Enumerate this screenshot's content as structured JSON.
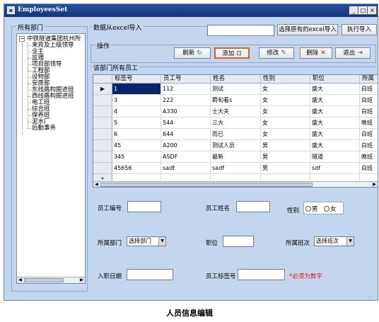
{
  "window": {
    "title": "EmployeesSet"
  },
  "titlebar_buttons": {
    "minimize": "_",
    "maximize": "□",
    "close": "×"
  },
  "sidebar": {
    "legend": "所有部门",
    "root": "中铁隧道集团杭州所",
    "items": [
      "来宾及上级领导",
      "业主",
      "监理",
      "项目部领导",
      "工程部",
      "设物部",
      "安质部",
      "东线盾构掘进班",
      "西线盾构掘进班",
      "电工班",
      "综合班",
      "保养班",
      "泥水厂",
      "后勤事务"
    ]
  },
  "import": {
    "legend": "数据从excel导入",
    "path_value": "",
    "choose_button": "选择原有的excel导入",
    "execute_button": "执行导入"
  },
  "actions": {
    "legend": "操作",
    "refresh": "刷新",
    "add": "添加",
    "edit": "修改",
    "delete": "删除",
    "exit": "退出"
  },
  "grid": {
    "legend": "该部门所有员工",
    "columns": [
      "标签号",
      "员工号",
      "姓名",
      "性别",
      "职位",
      "所属"
    ],
    "rows": [
      [
        "1",
        "112",
        "测试",
        "女",
        "盛大",
        "白班"
      ],
      [
        "3",
        "222",
        "羁旬看s",
        "女",
        "盛大",
        "白班"
      ],
      [
        "4",
        "A330",
        "士大夫",
        "女",
        "盛大",
        "白班"
      ],
      [
        "5",
        "544",
        "三大",
        "女",
        "盛大",
        "晚班"
      ],
      [
        "6",
        "644",
        "而已",
        "女",
        "盛大",
        "白班"
      ],
      [
        "45",
        "A200",
        "测试人员",
        "男",
        "盛大",
        "白班"
      ],
      [
        "345",
        "ASDF",
        "最新",
        "男",
        "隧道",
        "晚班"
      ],
      [
        "45656",
        "sadf",
        "sadf",
        "男",
        "sdf",
        "白班"
      ]
    ],
    "current_marker": "▶",
    "new_row_marker": "*"
  },
  "form": {
    "emp_no_label": "员工编号",
    "emp_name_label": "员工姓名",
    "gender_label": "性别",
    "gender_male": "男",
    "gender_female": "女",
    "dept_label": "所属部门",
    "dept_value": "选择部门",
    "position_label": "职位",
    "shift_label": "所属班次",
    "shift_value": "选择班次",
    "join_date_label": "入职日期",
    "tag_label": "员工标签号",
    "tag_hint": "*必须为数字"
  },
  "caption": "人员信息编辑",
  "colors": {
    "titlebar": "#13357c",
    "window_bg": "#c4d5ef",
    "selected_cell": "#0a246a",
    "hint": "#e0101a"
  }
}
